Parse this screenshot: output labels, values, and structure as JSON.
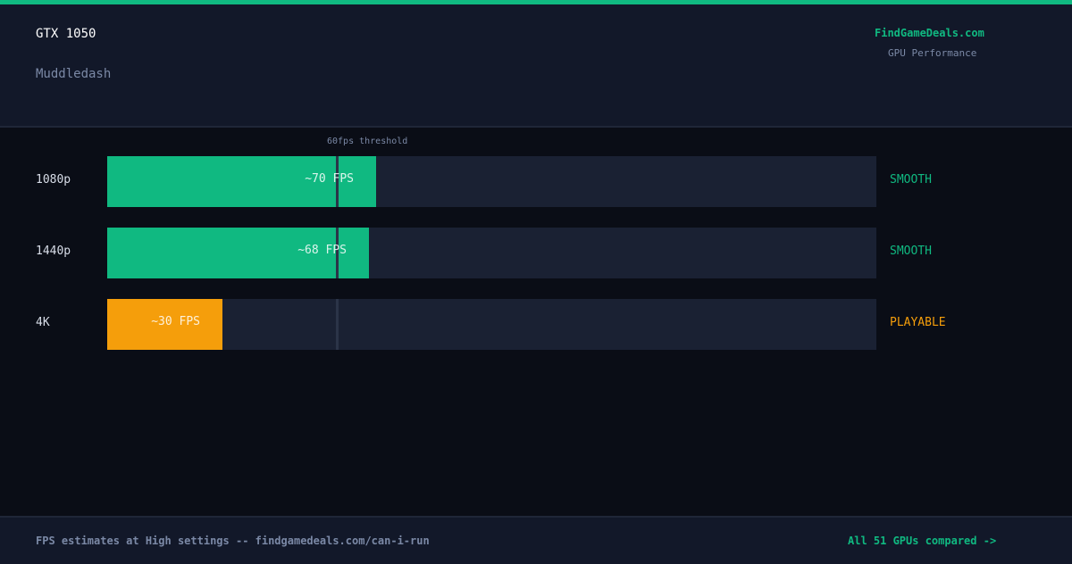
{
  "header": {
    "gpu_name": "GTX 1050",
    "game_name": "Muddledash",
    "brand": "FindGameDeals.com",
    "subtitle": "GPU Performance"
  },
  "colors": {
    "accent": "#10b981",
    "smooth": "#10b981",
    "playable": "#f59e0b",
    "track": "#1a2133"
  },
  "chart_data": {
    "type": "bar",
    "orientation": "horizontal",
    "categories": [
      "1080p",
      "1440p",
      "4K"
    ],
    "values": [
      70,
      68,
      30
    ],
    "value_labels": [
      "~70 FPS",
      "~68 FPS",
      "~30 FPS"
    ],
    "status": [
      "SMOOTH",
      "SMOOTH",
      "PLAYABLE"
    ],
    "status_colors": [
      "#10b981",
      "#10b981",
      "#f59e0b"
    ],
    "xlim": [
      0,
      200
    ],
    "threshold": 60,
    "threshold_label": "60fps threshold"
  },
  "footer": {
    "note": "FPS estimates at High settings -- findgamedeals.com/can-i-run",
    "link": "All 51 GPUs compared ->"
  }
}
